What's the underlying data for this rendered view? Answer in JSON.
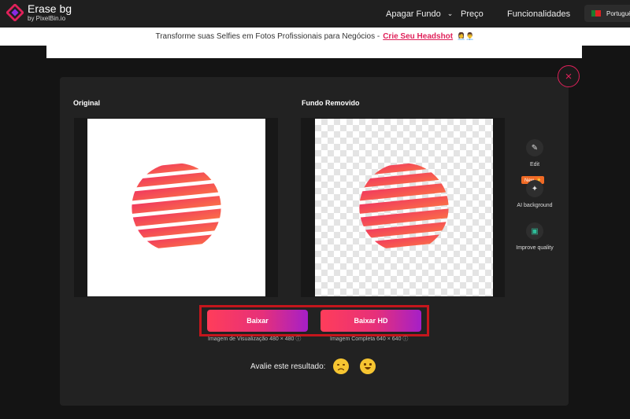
{
  "header": {
    "logo_title": "Erase bg",
    "logo_subtitle": "by PixelBin.io",
    "nav": {
      "apagar_fundo": "Apagar Fundo",
      "preco": "Preço",
      "funcionalidades": "Funcionalidades"
    },
    "language": "Português"
  },
  "banner": {
    "text": "Transforme suas Selfies em Fotos Profissionais para Negócios -",
    "link": "Crie Seu Headshot",
    "emoji": "👩‍💼👨‍💼"
  },
  "modal": {
    "close_icon": "×",
    "original_label": "Original",
    "removed_label": "Fundo Removido",
    "tools": {
      "edit": "Edit",
      "new_badge": "New ✨",
      "ai_background": "AI background",
      "improve_quality": "Improve quality"
    },
    "download": {
      "baixar": "Baixar",
      "baixar_hd": "Baixar HD",
      "preview_note": "Imagem de Visualização 480 × 480 ⓘ",
      "full_note": "Imagem Completa 640 × 640 ⓘ"
    },
    "rating": {
      "label": "Avalie este resultado:"
    }
  },
  "colors": {
    "accent": "#e0215a",
    "gradient_start": "#ff3d5a",
    "gradient_end": "#a51fc8",
    "highlight_frame": "#c4161c"
  }
}
